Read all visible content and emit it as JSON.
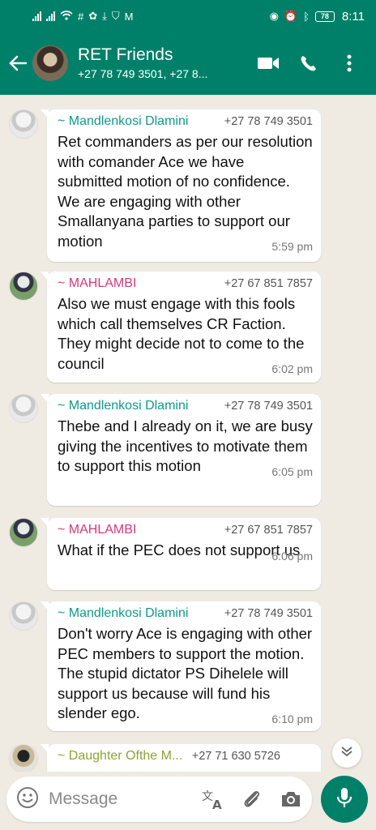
{
  "status_bar": {
    "time": "8:11",
    "battery": "78"
  },
  "header": {
    "title": "RET Friends",
    "subtitle": "+27 78 749 3501,  +27 8..."
  },
  "messages": [
    {
      "sender": "~ Mandlenkosi Dlamini",
      "phone": "+27 78 749 3501",
      "text": "Ret commanders as per our resolution with comander Ace we have submitted motion of no confidence. We are engaging with other Smallanyana parties to support our motion",
      "time": "5:59 pm"
    },
    {
      "sender": "~ MAHLAMBI",
      "phone": "+27 67 851 7857",
      "text": "Also we must engage with this fools which call themselves CR Faction. They might decide not to come to the council",
      "time": "6:02 pm"
    },
    {
      "sender": "~ Mandlenkosi Dlamini",
      "phone": "+27 78 749 3501",
      "text": "Thebe and I already on it, we are busy giving the incentives to motivate them to support this motion",
      "time": "6:05 pm"
    },
    {
      "sender": "~ MAHLAMBI",
      "phone": "+27 67 851 7857",
      "text": "What if the PEC does not support us",
      "time": "6:06 pm"
    },
    {
      "sender": "~ Mandlenkosi Dlamini",
      "phone": "+27 78 749 3501",
      "text": "Don't worry Ace is engaging with other PEC members to support the motion. The stupid dictator PS Dihelele will support us because will fund his slender ego.",
      "time": "6:10 pm"
    },
    {
      "sender": "~ Daughter Ofthe M...",
      "phone": "+27 71 630 5726",
      "text": "",
      "time": ""
    }
  ],
  "composer": {
    "placeholder": "Message"
  },
  "colors": {
    "primary": "#008069",
    "chat_bg": "#efeae2",
    "sender_teal": "#0e9a8c",
    "sender_pink": "#d6397c",
    "sender_olive": "#8da433"
  },
  "icons": [
    "back-arrow-icon",
    "video-call-icon",
    "phone-call-icon",
    "more-options-icon",
    "emoji-icon",
    "translate-icon",
    "attach-icon",
    "camera-icon",
    "mic-icon",
    "scroll-down-icon"
  ]
}
